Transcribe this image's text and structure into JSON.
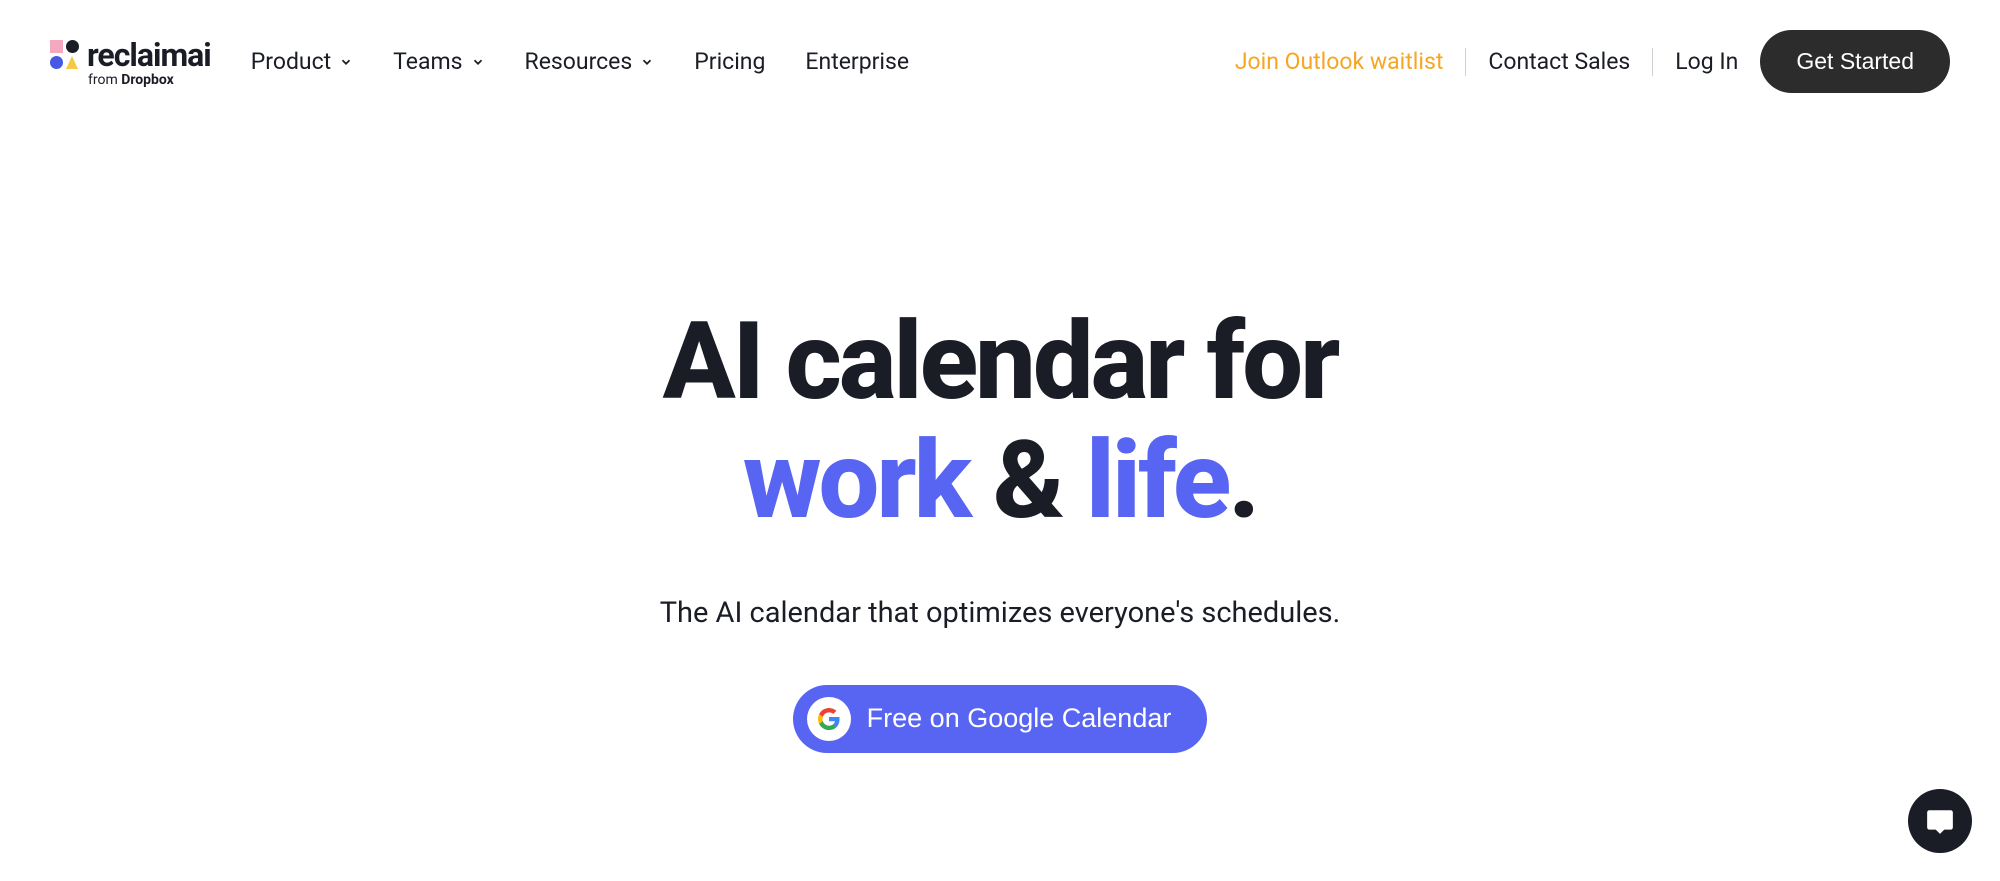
{
  "logo": {
    "text": "reclaimai",
    "subtext_prefix": "from ",
    "subtext_brand": "Dropbox"
  },
  "nav": {
    "left": [
      {
        "label": "Product",
        "dropdown": true
      },
      {
        "label": "Teams",
        "dropdown": true
      },
      {
        "label": "Resources",
        "dropdown": true
      },
      {
        "label": "Pricing",
        "dropdown": false
      },
      {
        "label": "Enterprise",
        "dropdown": false
      }
    ],
    "right": {
      "outlook": "Join Outlook waitlist",
      "contact": "Contact Sales",
      "login": "Log In",
      "get_started": "Get Started"
    }
  },
  "hero": {
    "title_line1": "AI calendar for",
    "title_word1": "work",
    "title_amp": " & ",
    "title_word2": "life",
    "title_period": ".",
    "subtitle": "The AI calendar that optimizes everyone's schedules.",
    "cta": "Free on Google Calendar"
  }
}
